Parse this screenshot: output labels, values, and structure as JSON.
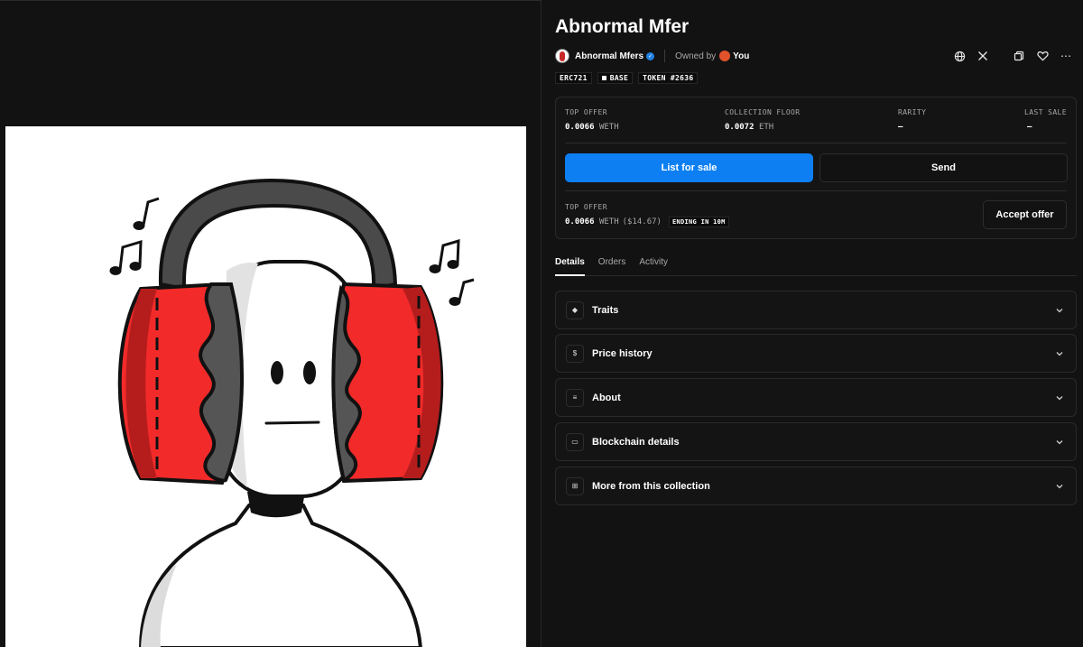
{
  "nft": {
    "title": "Abnormal Mfer",
    "collection": "Abnormal Mfers",
    "owned_label": "Owned by",
    "owner": "You",
    "tags": [
      "ERC721",
      "BASE",
      "TOKEN #2636"
    ]
  },
  "stats": {
    "top_offer_label": "TOP OFFER",
    "top_offer_value": "0.0066",
    "top_offer_unit": "WETH",
    "floor_label": "COLLECTION FLOOR",
    "floor_value": "0.0072",
    "floor_unit": "ETH",
    "rarity_label": "RARITY",
    "rarity_value": "–",
    "last_sale_label": "LAST SALE",
    "last_sale_value": "–"
  },
  "buttons": {
    "list": "List for sale",
    "send": "Send",
    "accept": "Accept offer"
  },
  "offer": {
    "label": "TOP OFFER",
    "value": "0.0066",
    "unit": "WETH",
    "usd": "($14.67)",
    "ending": "ENDING IN 10M"
  },
  "tabs": [
    "Details",
    "Orders",
    "Activity"
  ],
  "sections": [
    {
      "label": "Traits",
      "icon": "trait-icon"
    },
    {
      "label": "Price history",
      "icon": "dollar-icon"
    },
    {
      "label": "About",
      "icon": "text-icon"
    },
    {
      "label": "Blockchain details",
      "icon": "blockchain-icon"
    },
    {
      "label": "More from this collection",
      "icon": "grid-icon"
    }
  ],
  "colors": {
    "accent": "#0d7ff2",
    "background": "#121212",
    "card": "#141414",
    "muted_text": "#a8a8a8"
  }
}
